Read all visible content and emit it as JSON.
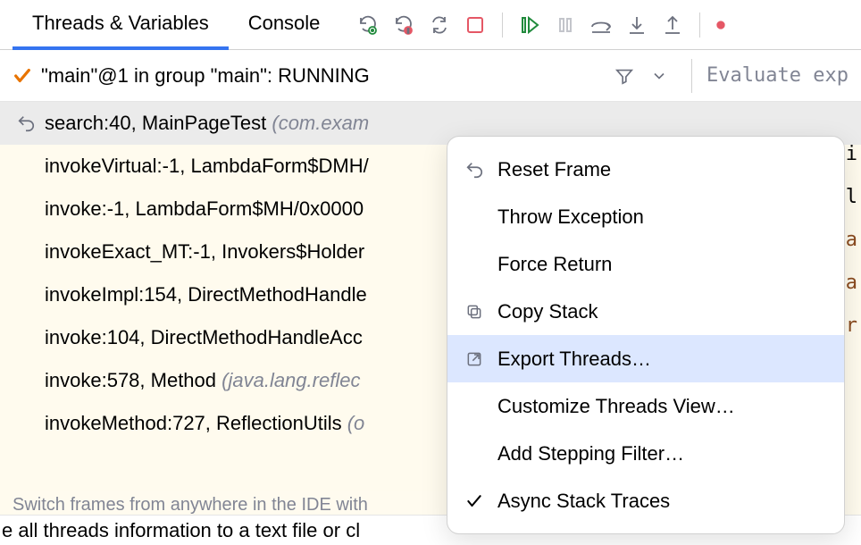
{
  "tabs": {
    "threads": "Threads & Variables",
    "console": "Console"
  },
  "thread": {
    "status": "\"main\"@1 in group \"main\": RUNNING"
  },
  "eval": {
    "placeholder": "Evaluate exp"
  },
  "frames": [
    {
      "method": "search:40, MainPageTest ",
      "pkg": "(com.exam",
      "current": true
    },
    {
      "method": "invokeVirtual:-1, LambdaForm$DMH/",
      "pkg": ""
    },
    {
      "method": "invoke:-1, LambdaForm$MH/0x0000",
      "pkg": ""
    },
    {
      "method": "invokeExact_MT:-1, Invokers$Holder",
      "pkg": ""
    },
    {
      "method": "invokeImpl:154, DirectMethodHandle",
      "pkg": ""
    },
    {
      "method": "invoke:104, DirectMethodHandleAcc",
      "pkg": ""
    },
    {
      "method": "invoke:578, Method ",
      "pkg": "(java.lang.reflec"
    },
    {
      "method": "invokeMethod:727, ReflectionUtils ",
      "pkg": "(o"
    }
  ],
  "hint": "Switch frames from anywhere in the IDE with",
  "statusbar": "e all threads information to a text file or cl",
  "context_menu": {
    "reset_frame": "Reset Frame",
    "throw_exception": "Throw Exception",
    "force_return": "Force Return",
    "copy_stack": "Copy Stack",
    "export_threads": "Export Threads…",
    "customize_view": "Customize Threads View…",
    "add_filter": "Add Stepping Filter…",
    "async_traces": "Async Stack Traces"
  },
  "peek": {
    "p1": "ni",
    "p2": "{l",
    "p3": "Pa",
    "p4": "Pa",
    "p5": "or"
  }
}
